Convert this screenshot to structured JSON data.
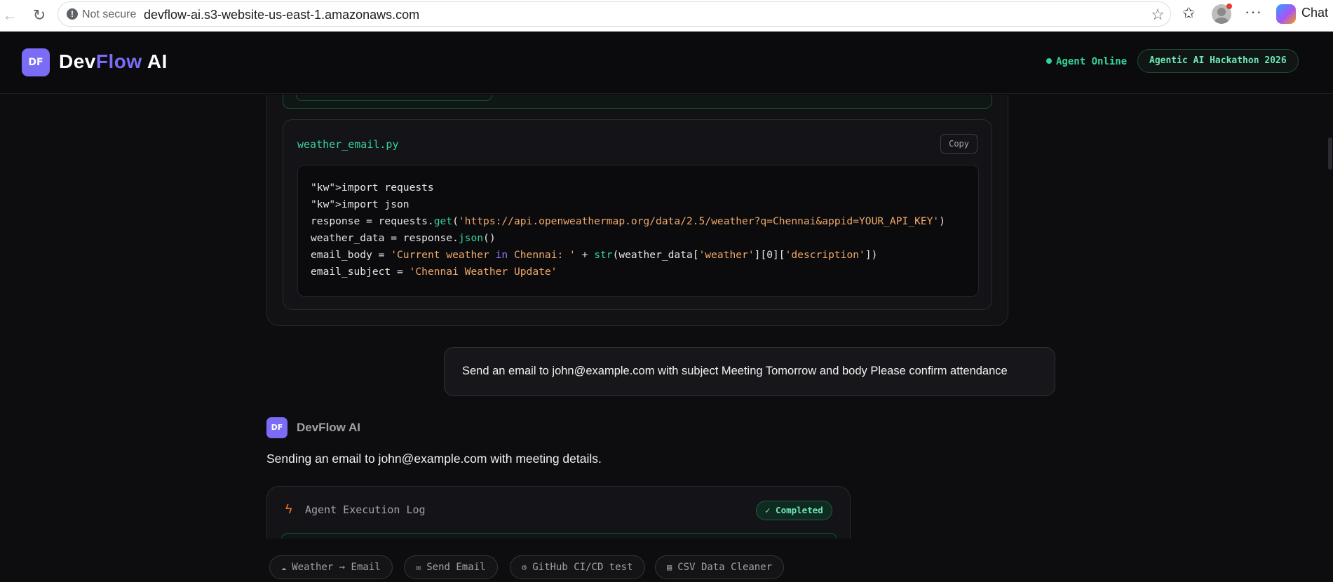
{
  "browser": {
    "security_label": "Not secure",
    "url": "devflow-ai.s3-website-us-east-1.amazonaws.com",
    "chat_label": "Chat",
    "icons": [
      "back-icon",
      "reload-icon",
      "warning-icon",
      "star-icon",
      "favorites-icon",
      "profile-icon",
      "more-icon",
      "copilot-icon"
    ]
  },
  "header": {
    "logo_initials": "DF",
    "brand_part1": "Dev",
    "brand_part2": "Flow",
    "brand_part3": " AI",
    "status": "Agent Online",
    "badge": "Agentic AI Hackathon 2026",
    "colors": {
      "accent": "#7b6cf6",
      "online": "#34d399"
    }
  },
  "code_card": {
    "filename": "weather_email.py",
    "copy_label": "Copy",
    "lines": [
      "\"kw\">import requests",
      "\"kw\">import json",
      "response = requests.get('https://api.openweathermap.org/data/2.5/weather?q=Chennai&appid=YOUR_API_KEY')",
      "weather_data = response.json()",
      "email_body = 'Current weather in Chennai: ' + str(weather_data['weather'][0]['description'])",
      "email_subject = 'Chennai Weather Update'"
    ]
  },
  "user_message": {
    "text": "Send an email to john@example.com with subject Meeting Tomorrow and body Please confirm attendance"
  },
  "ai_message": {
    "avatar": "DF",
    "name": "DevFlow AI",
    "text": "Sending an email to john@example.com with meeting details."
  },
  "execution_log": {
    "title": "Agent Execution Log",
    "status": "✓ Completed",
    "icon": "bolt-icon"
  },
  "quick_actions": [
    {
      "label": "Weather → Email",
      "icon": "cloud-icon",
      "glyph": "☁"
    },
    {
      "label": "Send Email",
      "icon": "mail-icon",
      "glyph": "✉"
    },
    {
      "label": "GitHub CI/CD test",
      "icon": "gear-icon",
      "glyph": "⚙"
    },
    {
      "label": "CSV Data Cleaner",
      "icon": "document-icon",
      "glyph": "▤"
    }
  ]
}
